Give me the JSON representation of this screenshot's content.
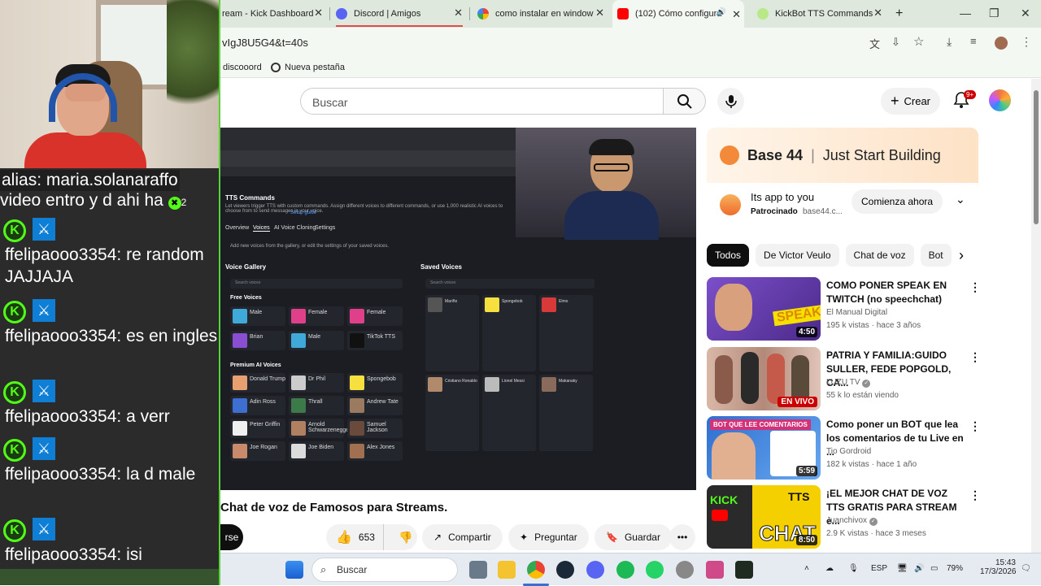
{
  "browser": {
    "tabs": [
      {
        "label": "ream - Kick Dashboard",
        "color": "#53fc18",
        "active": false
      },
      {
        "label": "Discord | Amigos",
        "color": "#5865f2",
        "active": false
      },
      {
        "label": "como instalar en window",
        "color": "#4285f4",
        "active": false
      },
      {
        "label": "(102) Cómo configura",
        "color": "#ff0000",
        "active": true
      },
      {
        "label": "KickBot TTS Commands",
        "color": "#b8e986",
        "active": false
      }
    ],
    "new_tab": "+",
    "url": "vIgJ8U5G4&t=40s",
    "bookmarks": [
      "discooord",
      "Nueva pestaña"
    ]
  },
  "overlay": {
    "alias_line1": "alias: maria.solanaraffo",
    "alias_line2": "video entro y d ahi ha",
    "alias_count": "2",
    "messages": [
      {
        "user": "ffelipaooo3354:",
        "text": "re random JAJJAJA"
      },
      {
        "user": "ffelipaooo3354:",
        "text": "es en ingles"
      },
      {
        "user": "ffelipaooo3354:",
        "text": "a verr"
      },
      {
        "user": "ffelipaooo3354:",
        "text": "la d male"
      },
      {
        "user": "ffelipaooo3354:",
        "text": "isi"
      }
    ],
    "badge_letter": "K"
  },
  "youtube": {
    "search_placeholder": "Buscar",
    "create_label": "Crear",
    "notif_count": "9+",
    "video_title": "Chat de voz de Famosos para Streams.",
    "subscribe_label": "rse",
    "likes": "653",
    "share_label": "Compartir",
    "ask_label": "Preguntar",
    "save_label": "Guardar",
    "ad": {
      "brand": "Base 44",
      "tagline": "Just Start Building",
      "title": "Its app to you",
      "sponsored": "Patrocinado",
      "domain": "base44.c...",
      "cta": "Comienza ahora"
    },
    "chips": [
      "Todos",
      "De Victor Veulo",
      "Chat de voz",
      "Bot"
    ],
    "recommendations": [
      {
        "title": "COMO PONER SPEAK EN TWITCH (no speechchat)",
        "channel": "El Manual Digital",
        "meta": "195 k vistas · hace 3 años",
        "badge": "4:50",
        "live": false,
        "thumb": "#5b3b8a"
      },
      {
        "title": "PATRIA Y FAMILIA:GUIDO SULLER, FEDE POPGOLD, CA...",
        "channel": "LUZU TV",
        "meta": "55 k lo están viendo",
        "badge": "EN VIVO",
        "live": true,
        "thumb": "#c7a79a"
      },
      {
        "title": "Como poner un BOT que lea los comentarios de tu Live en ...",
        "channel": "Tio Gordroid",
        "meta": "182 k vistas · hace 1 año",
        "badge": "5:59",
        "live": false,
        "thumb": "#3a7bd5"
      },
      {
        "title": "¡EL MEJOR CHAT DE VOZ TTS GRATIS PARA STREAM e...",
        "channel": "Juanchivox",
        "meta": "2.9 K vistas · hace 3 meses",
        "badge": "8:50",
        "live": false,
        "thumb": "#e8c21a"
      }
    ],
    "in_video": {
      "heading": "TTS Commands",
      "description": "Let viewers trigger TTS with custom commands. Assign different voices to different commands, or use 1,000 realistic AI voices to choose from to send messages in your voice.",
      "setup": "Setup guide",
      "tabs": [
        "Overview",
        "Voices",
        "AI Voice Cloning",
        "Settings"
      ],
      "hint": "Add new voices from the gallery, or edit the settings of your saved voices.",
      "gallery_title": "Voice Gallery",
      "saved_title": "Saved Voices",
      "search_voices": "Search voices",
      "free_voices": "Free Voices",
      "premium_voices": "Premium AI Voices",
      "free": [
        "Male",
        "Female",
        "Female",
        "Brian",
        "Male",
        "TikTok TTS"
      ],
      "premium": [
        "Donald Trump",
        "Dr Phil",
        "Spongebob",
        "Adin Ross",
        "Thrall",
        "Andrew Tate",
        "Peter Griffin",
        "Arnold Schwarzenegger",
        "Samuel Jackson",
        "Joe Rogan",
        "Joe Biden",
        "Alex Jones"
      ],
      "saved": [
        "Mariño",
        "Spongebob",
        "Elmo",
        "Cristiano Ronaldo",
        "Lionel Messi",
        "Makanaky"
      ]
    }
  },
  "taskbar": {
    "search": "Buscar",
    "lang": "ESP",
    "battery": "79%",
    "time": "15:43",
    "date": "17/3/2026"
  }
}
